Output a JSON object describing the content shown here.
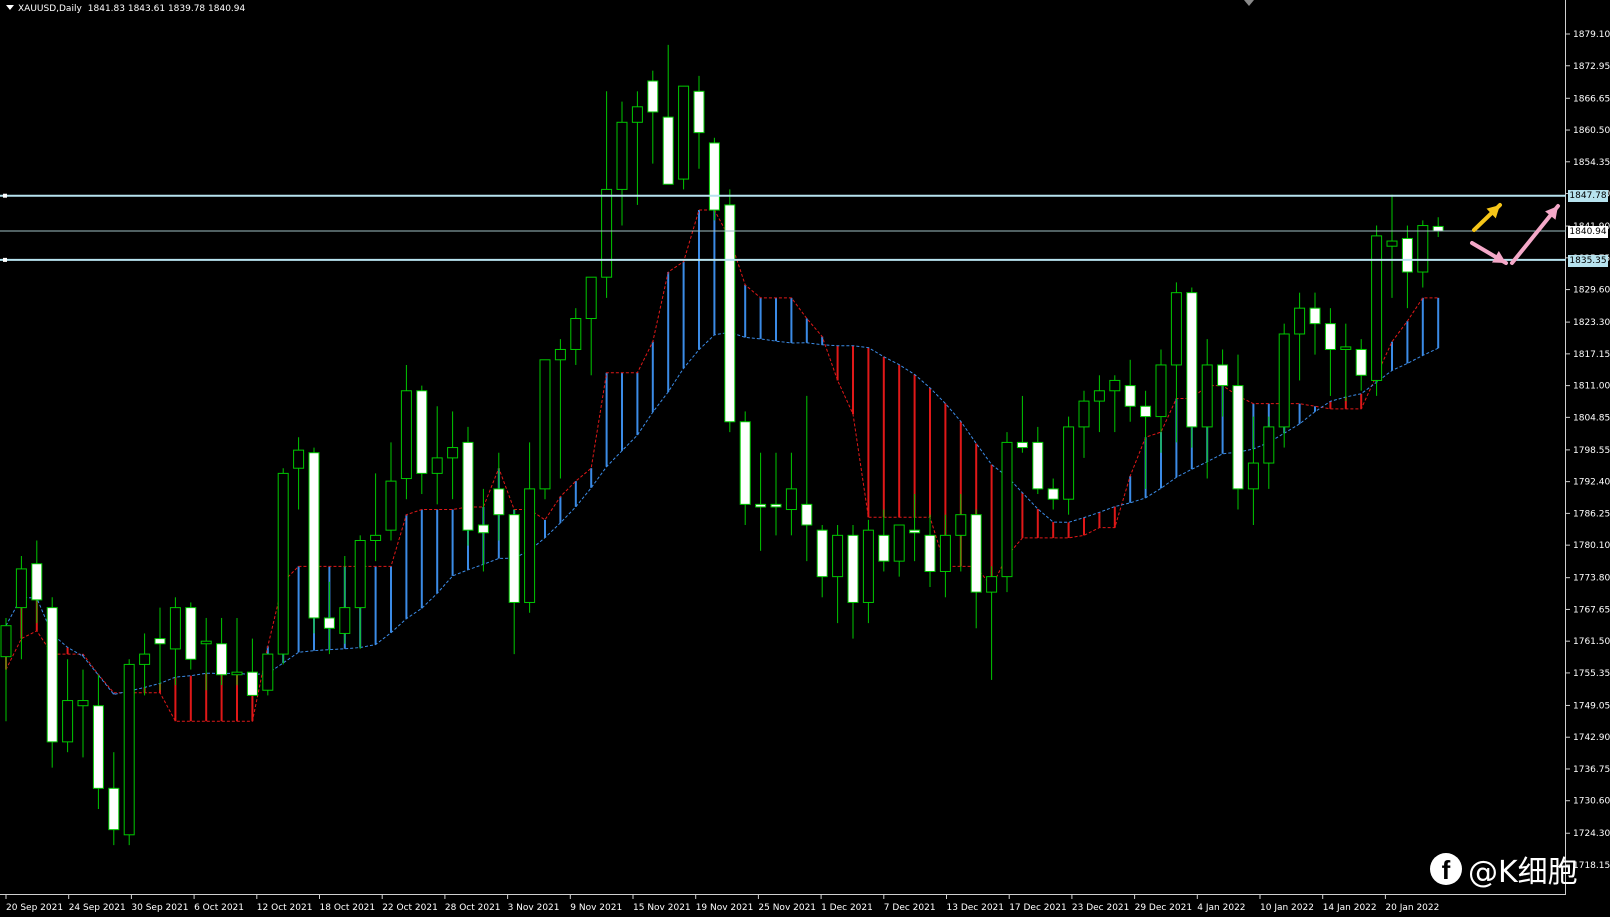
{
  "header": {
    "symbol": "XAUUSD,Daily",
    "ohlc": "1841.83 1843.61 1839.78 1840.94"
  },
  "price_axis": {
    "labels": [
      "1879.10",
      "1872.95",
      "1866.65",
      "1860.50",
      "1854.35",
      "1848.20",
      "1841.90",
      "1835.75",
      "1829.60",
      "1823.30",
      "1817.15",
      "1811.00",
      "1804.85",
      "1798.55",
      "1792.40",
      "1786.25",
      "1780.10",
      "1773.80",
      "1767.65",
      "1761.50",
      "1755.35",
      "1749.05",
      "1742.90",
      "1736.75",
      "1730.60",
      "1724.30",
      "1718.15"
    ]
  },
  "time_axis": {
    "labels": [
      "20 Sep 2021",
      "24 Sep 2021",
      "30 Sep 2021",
      "6 Oct 2021",
      "12 Oct 2021",
      "18 Oct 2021",
      "22 Oct 2021",
      "28 Oct 2021",
      "3 Nov 2021",
      "9 Nov 2021",
      "15 Nov 2021",
      "19 Nov 2021",
      "25 Nov 2021",
      "1 Dec 2021",
      "7 Dec 2021",
      "13 Dec 2021",
      "17 Dec 2021",
      "23 Dec 2021",
      "29 Dec 2021",
      "4 Jan 2022",
      "10 Jan 2022",
      "14 Jan 2022",
      "20 Jan 2022"
    ]
  },
  "levels": {
    "upper": "1847.78",
    "current": "1840.94",
    "lower": "1835.35"
  },
  "annotations": {
    "arrows": [
      {
        "color": "#f5c518",
        "direction": "up"
      },
      {
        "color": "#f4a8c8",
        "direction": "down"
      },
      {
        "color": "#f4a8c8",
        "direction": "up"
      }
    ]
  },
  "watermark": {
    "icon": "facebook-icon",
    "text": "@K细胞"
  },
  "colors": {
    "background": "#000000",
    "bull_body": "#000000",
    "bear_body": "#ffffff",
    "wick": "#00c800",
    "cloud_bull": "#3b8be6",
    "cloud_bear": "#e01818",
    "level_line": "#b7e3ef"
  },
  "chart_data": {
    "type": "candlestick",
    "symbol": "XAUUSD",
    "timeframe": "Daily",
    "candles": [
      {
        "o": 1758.5,
        "h": 1766.0,
        "l": 1746.0,
        "c": 1764.5
      },
      {
        "o": 1768.0,
        "h": 1778.0,
        "l": 1758.0,
        "c": 1775.5
      },
      {
        "o": 1776.5,
        "h": 1781.0,
        "l": 1765.0,
        "c": 1769.5
      },
      {
        "o": 1768.0,
        "h": 1770.0,
        "l": 1737.0,
        "c": 1742.0
      },
      {
        "o": 1742.0,
        "h": 1758.0,
        "l": 1740.0,
        "c": 1750.0
      },
      {
        "o": 1749.0,
        "h": 1756.0,
        "l": 1739.0,
        "c": 1750.0
      },
      {
        "o": 1749.0,
        "h": 1755.0,
        "l": 1729.0,
        "c": 1733.0
      },
      {
        "o": 1733.0,
        "h": 1740.0,
        "l": 1722.0,
        "c": 1725.0
      },
      {
        "o": 1724.0,
        "h": 1758.0,
        "l": 1722.0,
        "c": 1757.0
      },
      {
        "o": 1757.0,
        "h": 1763.0,
        "l": 1751.0,
        "c": 1759.0
      },
      {
        "o": 1762.0,
        "h": 1768.0,
        "l": 1752.0,
        "c": 1761.0
      },
      {
        "o": 1760.0,
        "h": 1770.0,
        "l": 1753.0,
        "c": 1768.0
      },
      {
        "o": 1768.0,
        "h": 1769.0,
        "l": 1756.0,
        "c": 1758.0
      },
      {
        "o": 1761.0,
        "h": 1766.0,
        "l": 1752.0,
        "c": 1761.5
      },
      {
        "o": 1761.0,
        "h": 1766.0,
        "l": 1753.0,
        "c": 1755.0
      },
      {
        "o": 1755.0,
        "h": 1766.0,
        "l": 1753.0,
        "c": 1755.5
      },
      {
        "o": 1755.5,
        "h": 1762.0,
        "l": 1753.0,
        "c": 1751.0
      },
      {
        "o": 1752.0,
        "h": 1758.0,
        "l": 1751.0,
        "c": 1759.0
      },
      {
        "o": 1759.0,
        "h": 1795.0,
        "l": 1757.0,
        "c": 1794.0
      },
      {
        "o": 1795.0,
        "h": 1801.0,
        "l": 1787.0,
        "c": 1798.5
      },
      {
        "o": 1798.0,
        "h": 1799.0,
        "l": 1763.0,
        "c": 1766.0
      },
      {
        "o": 1766.0,
        "h": 1773.0,
        "l": 1759.0,
        "c": 1764.0
      },
      {
        "o": 1763.0,
        "h": 1778.0,
        "l": 1761.0,
        "c": 1768.0
      },
      {
        "o": 1768.0,
        "h": 1782.0,
        "l": 1760.0,
        "c": 1781.0
      },
      {
        "o": 1781.0,
        "h": 1794.0,
        "l": 1777.0,
        "c": 1782.0
      },
      {
        "o": 1783.0,
        "h": 1800.0,
        "l": 1781.0,
        "c": 1792.5
      },
      {
        "o": 1793.0,
        "h": 1815.0,
        "l": 1789.0,
        "c": 1810.0
      },
      {
        "o": 1810.0,
        "h": 1811.0,
        "l": 1790.0,
        "c": 1794.0
      },
      {
        "o": 1794.0,
        "h": 1807.0,
        "l": 1788.0,
        "c": 1797.0
      },
      {
        "o": 1797.0,
        "h": 1806.0,
        "l": 1789.0,
        "c": 1799.0
      },
      {
        "o": 1800.0,
        "h": 1803.0,
        "l": 1780.0,
        "c": 1783.0
      },
      {
        "o": 1784.0,
        "h": 1791.0,
        "l": 1775.0,
        "c": 1782.5
      },
      {
        "o": 1791.0,
        "h": 1798.0,
        "l": 1781.0,
        "c": 1786.0
      },
      {
        "o": 1786.0,
        "h": 1787.0,
        "l": 1759.0,
        "c": 1769.0
      },
      {
        "o": 1769.0,
        "h": 1800.0,
        "l": 1767.0,
        "c": 1791.0
      },
      {
        "o": 1791.0,
        "h": 1801.0,
        "l": 1789.0,
        "c": 1816.0
      },
      {
        "o": 1816.0,
        "h": 1820.0,
        "l": 1793.0,
        "c": 1818.0
      },
      {
        "o": 1818.0,
        "h": 1826.0,
        "l": 1815.0,
        "c": 1824.0
      },
      {
        "o": 1824.0,
        "h": 1831.0,
        "l": 1813.0,
        "c": 1832.0
      },
      {
        "o": 1832.0,
        "h": 1868.0,
        "l": 1828.0,
        "c": 1849.0
      },
      {
        "o": 1849.0,
        "h": 1866.0,
        "l": 1842.0,
        "c": 1862.0
      },
      {
        "o": 1862.0,
        "h": 1868.0,
        "l": 1846.0,
        "c": 1865.0
      },
      {
        "o": 1870.0,
        "h": 1872.0,
        "l": 1854.0,
        "c": 1864.0
      },
      {
        "o": 1863.0,
        "h": 1877.0,
        "l": 1850.0,
        "c": 1850.0
      },
      {
        "o": 1851.0,
        "h": 1869.0,
        "l": 1849.0,
        "c": 1869.0
      },
      {
        "o": 1868.0,
        "h": 1871.0,
        "l": 1853.0,
        "c": 1860.0
      },
      {
        "o": 1858.0,
        "h": 1859.0,
        "l": 1843.0,
        "c": 1845.0
      },
      {
        "o": 1846.0,
        "h": 1849.0,
        "l": 1802.0,
        "c": 1804.0
      },
      {
        "o": 1804.0,
        "h": 1806.0,
        "l": 1784.0,
        "c": 1788.0
      },
      {
        "o": 1788.0,
        "h": 1798.0,
        "l": 1779.0,
        "c": 1787.5
      },
      {
        "o": 1788.0,
        "h": 1798.0,
        "l": 1782.0,
        "c": 1787.5
      },
      {
        "o": 1787.0,
        "h": 1798.0,
        "l": 1782.0,
        "c": 1791.0
      },
      {
        "o": 1788.0,
        "h": 1809.0,
        "l": 1777.0,
        "c": 1784.0
      },
      {
        "o": 1783.0,
        "h": 1784.0,
        "l": 1770.0,
        "c": 1774.0
      },
      {
        "o": 1774.0,
        "h": 1784.0,
        "l": 1765.0,
        "c": 1782.0
      },
      {
        "o": 1782.0,
        "h": 1784.0,
        "l": 1762.0,
        "c": 1769.0
      },
      {
        "o": 1769.0,
        "h": 1785.0,
        "l": 1765.0,
        "c": 1783.0
      },
      {
        "o": 1782.0,
        "h": 1787.0,
        "l": 1775.0,
        "c": 1777.0
      },
      {
        "o": 1777.0,
        "h": 1784.0,
        "l": 1774.0,
        "c": 1784.0
      },
      {
        "o": 1783.0,
        "h": 1790.0,
        "l": 1777.0,
        "c": 1782.5
      },
      {
        "o": 1782.0,
        "h": 1786.0,
        "l": 1772.0,
        "c": 1775.0
      },
      {
        "o": 1775.0,
        "h": 1786.0,
        "l": 1770.0,
        "c": 1782.0
      },
      {
        "o": 1782.0,
        "h": 1790.0,
        "l": 1775.0,
        "c": 1786.0
      },
      {
        "o": 1786.0,
        "h": 1787.0,
        "l": 1764.0,
        "c": 1771.0
      },
      {
        "o": 1771.0,
        "h": 1776.0,
        "l": 1754.0,
        "c": 1774.0
      },
      {
        "o": 1774.0,
        "h": 1802.0,
        "l": 1771.0,
        "c": 1800.0
      },
      {
        "o": 1800.0,
        "h": 1809.0,
        "l": 1798.0,
        "c": 1799.0
      },
      {
        "o": 1800.0,
        "h": 1803.0,
        "l": 1790.0,
        "c": 1791.0
      },
      {
        "o": 1791.0,
        "h": 1793.0,
        "l": 1787.0,
        "c": 1789.0
      },
      {
        "o": 1789.0,
        "h": 1805.0,
        "l": 1786.0,
        "c": 1803.0
      },
      {
        "o": 1803.0,
        "h": 1810.0,
        "l": 1797.0,
        "c": 1808.0
      },
      {
        "o": 1808.0,
        "h": 1813.0,
        "l": 1802.0,
        "c": 1810.0
      },
      {
        "o": 1810.0,
        "h": 1813.0,
        "l": 1802.0,
        "c": 1812.0
      },
      {
        "o": 1811.0,
        "h": 1816.0,
        "l": 1804.0,
        "c": 1807.0
      },
      {
        "o": 1807.0,
        "h": 1810.0,
        "l": 1791.0,
        "c": 1805.0
      },
      {
        "o": 1805.0,
        "h": 1818.0,
        "l": 1798.0,
        "c": 1815.0
      },
      {
        "o": 1815.0,
        "h": 1831.0,
        "l": 1800.0,
        "c": 1829.0
      },
      {
        "o": 1829.0,
        "h": 1830.0,
        "l": 1799.0,
        "c": 1803.0
      },
      {
        "o": 1803.0,
        "h": 1820.0,
        "l": 1793.0,
        "c": 1815.0
      },
      {
        "o": 1815.0,
        "h": 1818.0,
        "l": 1805.0,
        "c": 1811.0
      },
      {
        "o": 1811.0,
        "h": 1817.0,
        "l": 1787.0,
        "c": 1791.0
      },
      {
        "o": 1791.0,
        "h": 1805.0,
        "l": 1784.0,
        "c": 1796.0
      },
      {
        "o": 1796.0,
        "h": 1805.0,
        "l": 1791.0,
        "c": 1803.0
      },
      {
        "o": 1803.0,
        "h": 1823.0,
        "l": 1799.0,
        "c": 1821.0
      },
      {
        "o": 1821.0,
        "h": 1829.0,
        "l": 1812.0,
        "c": 1826.0
      },
      {
        "o": 1826.0,
        "h": 1829.0,
        "l": 1817.0,
        "c": 1823.0
      },
      {
        "o": 1823.0,
        "h": 1826.0,
        "l": 1809.0,
        "c": 1818.0
      },
      {
        "o": 1818.0,
        "h": 1823.0,
        "l": 1808.0,
        "c": 1818.5
      },
      {
        "o": 1818.0,
        "h": 1820.0,
        "l": 1810.0,
        "c": 1813.0
      },
      {
        "o": 1812.0,
        "h": 1842.0,
        "l": 1809.0,
        "c": 1840.0
      },
      {
        "o": 1838.0,
        "h": 1848.0,
        "l": 1828.0,
        "c": 1839.0
      },
      {
        "o": 1839.5,
        "h": 1842.0,
        "l": 1826.0,
        "c": 1833.0
      },
      {
        "o": 1833.0,
        "h": 1843.0,
        "l": 1830.0,
        "c": 1842.0
      },
      {
        "o": 1841.83,
        "h": 1843.61,
        "l": 1839.78,
        "c": 1840.94
      }
    ]
  }
}
